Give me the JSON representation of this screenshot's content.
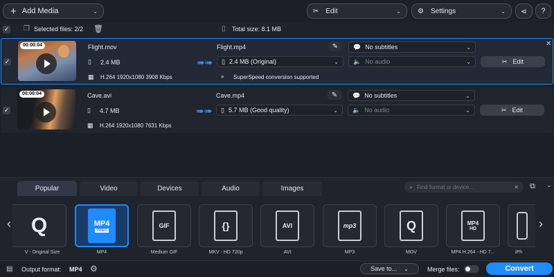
{
  "toolbar": {
    "add_media_label": "Add Media",
    "edit_label": "Edit",
    "settings_label": "Settings"
  },
  "selection_bar": {
    "selected_files_label": "Selected files: 2/2",
    "total_size_label": "Total size: 8.1 MB"
  },
  "files": [
    {
      "duration": "00:00:04",
      "source_name": "Flight.mov",
      "source_size": "2.4 MB",
      "codec_info": "H.264 1920x1080 3908 Kbps",
      "output_name": "Flight.mp4",
      "output_quality": "2.4 MB (Original)",
      "subtitles": "No subtitles",
      "audio": "No audio",
      "edit_label": "Edit",
      "superspeed_note": "SuperSpeed conversion supported"
    },
    {
      "duration": "00:00:04",
      "source_name": "Cave.avi",
      "source_size": "4.7 MB",
      "codec_info": "H.264 1920x1080 7631 Kbps",
      "output_name": "Cave.mp4",
      "output_quality": "5.7 MB (Good quality)",
      "subtitles": "No subtitles",
      "audio": "No audio",
      "edit_label": "Edit"
    }
  ],
  "format_panel": {
    "tabs": [
      "Popular",
      "Video",
      "Devices",
      "Audio",
      "Images"
    ],
    "active_tab": "Popular",
    "search_placeholder": "Find format or device...",
    "formats": [
      {
        "label": "V - Original Size",
        "icon": "quicktime-icon"
      },
      {
        "label": "MP4",
        "icon": "mp4-icon",
        "badge": "MP4"
      },
      {
        "label": "Medium GIF",
        "icon": "gif-icon",
        "badge": "GIF"
      },
      {
        "label": "MKV - HD 720p",
        "icon": "mkv-icon"
      },
      {
        "label": "AVI",
        "icon": "avi-icon",
        "badge": "AVI"
      },
      {
        "label": "MP3",
        "icon": "mp3-icon",
        "badge": "mp3"
      },
      {
        "label": "MOV",
        "icon": "quicktime-icon"
      },
      {
        "label": "MP4 H.264 - HD 7...",
        "icon": "mp4-hd-icon",
        "badge": "MP4"
      },
      {
        "label": "iPh",
        "icon": "iphone-icon"
      }
    ]
  },
  "bottom_bar": {
    "output_format_label": "Output format:",
    "output_format_value": "MP4",
    "save_to_label": "Save to...",
    "merge_files_label": "Merge files:",
    "convert_label": "Convert"
  },
  "colors": {
    "accent": "#1e8bff",
    "background": "#1b1f27",
    "selected_row": "#222834"
  }
}
